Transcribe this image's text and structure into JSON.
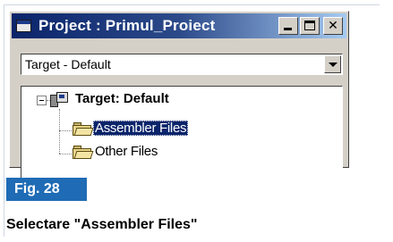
{
  "window": {
    "title": "Project : Primul_Proiect",
    "controls": [
      "minimize",
      "maximize",
      "close"
    ]
  },
  "combobox": {
    "selected": "Target - Default"
  },
  "tree": {
    "root": {
      "label": "Target: Default",
      "icon": "target-icon",
      "expanded": true,
      "children": [
        {
          "label": "Assembler Files",
          "icon": "folder-icon",
          "selected": true
        },
        {
          "label": "Other Files",
          "icon": "folder-icon",
          "selected": false
        }
      ]
    }
  },
  "figure": {
    "badge": "Fig. 28",
    "caption": "Selectare \"Assembler Files\"",
    "badge_color": "#1f6bb5"
  }
}
